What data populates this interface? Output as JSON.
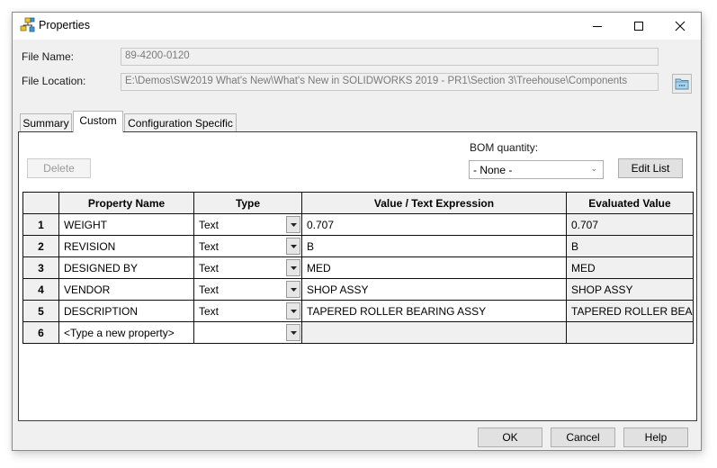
{
  "window": {
    "title": "Properties",
    "controls": {
      "minimize": "minimize",
      "maximize": "maximize",
      "close": "close"
    }
  },
  "fields": {
    "file_name_label": "File Name:",
    "file_name_value": "89-4200-0120",
    "file_location_label": "File Location:",
    "file_location_value": "E:\\Demos\\SW2019 What's New\\What's New in SOLIDWORKS 2019 - PR1\\Section 3\\Treehouse\\Components"
  },
  "tabs": [
    {
      "label": "Summary",
      "active": false
    },
    {
      "label": "Custom",
      "active": true
    },
    {
      "label": "Configuration Specific",
      "active": false
    }
  ],
  "custom": {
    "delete_label": "Delete",
    "bom_quantity_label": "BOM quantity:",
    "bom_quantity_value": "- None -",
    "edit_list_label": "Edit List"
  },
  "table": {
    "headers": [
      "",
      "Property Name",
      "Type",
      "Value / Text Expression",
      "Evaluated Value"
    ],
    "rows": [
      {
        "num": "1",
        "name": "WEIGHT",
        "type": "Text",
        "value": "0.707",
        "evaluated": "0.707"
      },
      {
        "num": "2",
        "name": "REVISION",
        "type": "Text",
        "value": "B",
        "evaluated": "B"
      },
      {
        "num": "3",
        "name": "DESIGNED BY",
        "type": "Text",
        "value": "MED",
        "evaluated": "MED"
      },
      {
        "num": "4",
        "name": "VENDOR",
        "type": "Text",
        "value": "SHOP ASSY",
        "evaluated": "SHOP ASSY"
      },
      {
        "num": "5",
        "name": "DESCRIPTION",
        "type": "Text",
        "value": "TAPERED ROLLER BEARING ASSY",
        "evaluated": "TAPERED ROLLER BEARING ASSY"
      },
      {
        "num": "6",
        "name": "<Type a new property>",
        "type": "",
        "value": "",
        "evaluated": ""
      }
    ]
  },
  "footer": {
    "ok_label": "OK",
    "cancel_label": "Cancel",
    "help_label": "Help"
  }
}
